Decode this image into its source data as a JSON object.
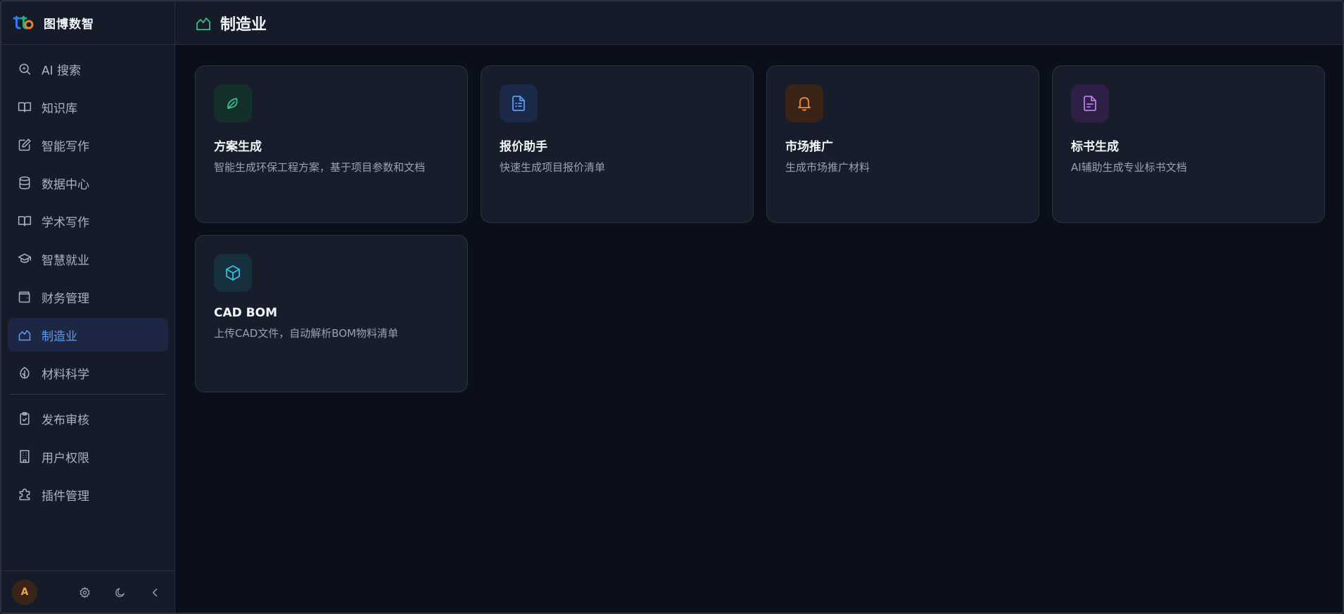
{
  "brand": {
    "name": "图博数智"
  },
  "header": {
    "title": "制造业",
    "icon": "factory-icon"
  },
  "sidebar": {
    "items": [
      {
        "label": "AI 搜索",
        "icon": "search-sparkle-icon"
      },
      {
        "label": "知识库",
        "icon": "book-open-icon"
      },
      {
        "label": "智能写作",
        "icon": "edit-icon"
      },
      {
        "label": "数据中心",
        "icon": "database-icon"
      },
      {
        "label": "学术写作",
        "icon": "book-open-icon"
      },
      {
        "label": "智慧就业",
        "icon": "graduation-cap-icon"
      },
      {
        "label": "财务管理",
        "icon": "wallet-icon"
      },
      {
        "label": "制造业",
        "icon": "factory-icon",
        "active": true
      },
      {
        "label": "材料科学",
        "icon": "leaf-icon"
      }
    ],
    "admin_items": [
      {
        "label": "发布审核",
        "icon": "clipboard-check-icon"
      },
      {
        "label": "用户权限",
        "icon": "building-icon"
      },
      {
        "label": "插件管理",
        "icon": "puzzle-icon"
      }
    ]
  },
  "footer": {
    "avatar_initial": "A",
    "buttons": [
      "settings-icon",
      "moon-icon",
      "chevron-left-icon"
    ]
  },
  "cards": [
    {
      "title": "方案生成",
      "desc": "智能生成环保工程方案，基于项目参数和文档",
      "icon": "leaf-icon",
      "accent": "#3dbd84",
      "bg": "#15302a"
    },
    {
      "title": "报价助手",
      "desc": "快速生成项目报价清单",
      "icon": "file-list-icon",
      "accent": "#5b9cf5",
      "bg": "#1c2a4a"
    },
    {
      "title": "市场推广",
      "desc": "生成市场推广材料",
      "icon": "bell-icon",
      "accent": "#f08a3c",
      "bg": "#3a2418"
    },
    {
      "title": "标书生成",
      "desc": "AI辅助生成专业标书文档",
      "icon": "file-signature-icon",
      "accent": "#b57cf0",
      "bg": "#2e1f45"
    },
    {
      "title": "CAD BOM",
      "desc": "上传CAD文件，自动解析BOM物料清单",
      "icon": "box-icon",
      "accent": "#36c0e0",
      "bg": "#16303d"
    }
  ]
}
